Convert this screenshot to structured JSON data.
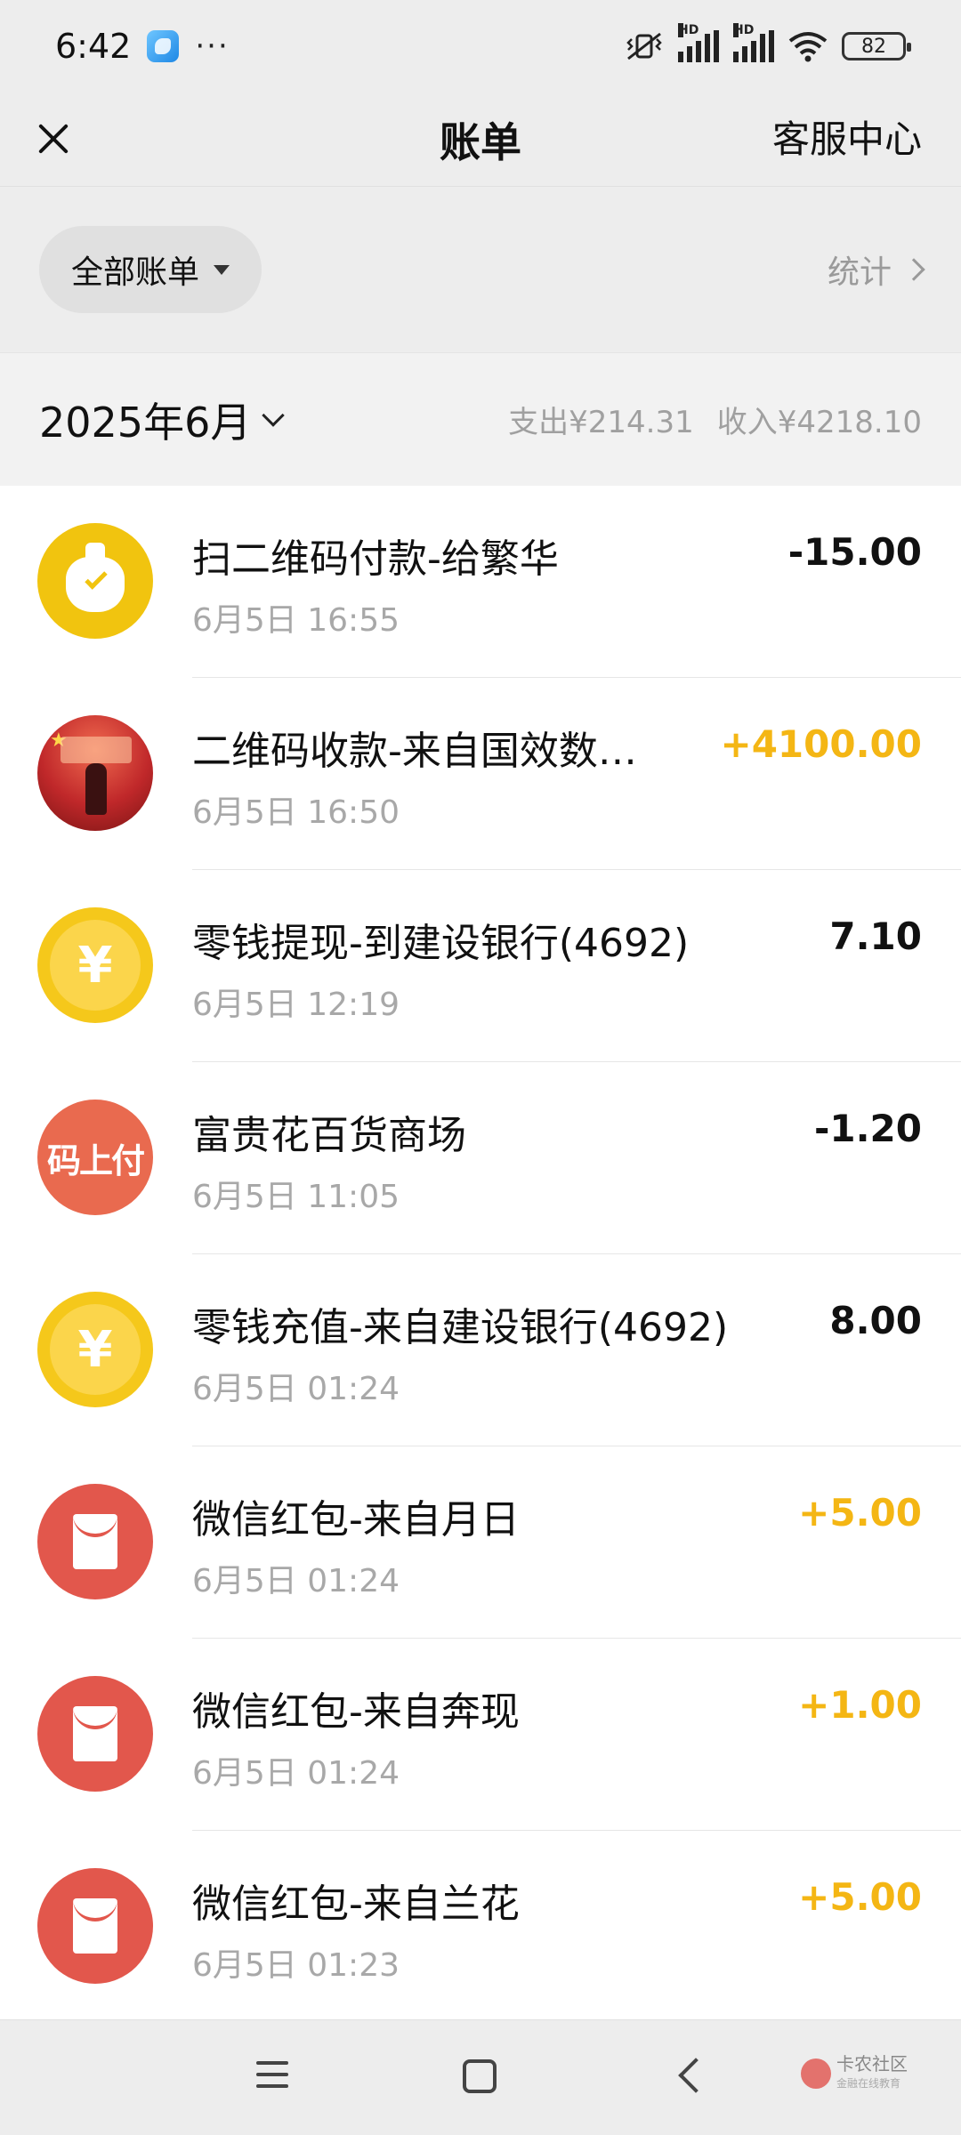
{
  "status_bar": {
    "time": "6:42",
    "more": "···",
    "hd1": "HD",
    "hd2": "HD",
    "battery": "82"
  },
  "header": {
    "title": "账单",
    "service": "客服中心"
  },
  "filter": {
    "label": "全部账单",
    "stats": "统计"
  },
  "month": {
    "label": "2025年6月",
    "expense": "支出¥214.31",
    "income": "收入¥4218.10"
  },
  "transactions": [
    {
      "title": "扫二维码付款-给繁华",
      "time": "6月5日 16:55",
      "amount": "-15.00",
      "type": "expense",
      "icon": "money-bag-icon"
    },
    {
      "title": "二维码收款-来自国效数…",
      "time": "6月5日 16:50",
      "amount": "+4100.00",
      "type": "income",
      "icon": "user-avatar"
    },
    {
      "title": "零钱提现-到建设银行(4692)",
      "time": "6月5日 12:19",
      "amount": "7.10",
      "type": "neutral",
      "icon": "yuan-coin-icon"
    },
    {
      "title": "富贵花百货商场",
      "time": "6月5日 11:05",
      "amount": "-1.20",
      "type": "expense",
      "icon": "code-pay-icon"
    },
    {
      "title": "零钱充值-来自建设银行(4692)",
      "time": "6月5日 01:24",
      "amount": "8.00",
      "type": "neutral",
      "icon": "yuan-coin-icon"
    },
    {
      "title": "微信红包-来自月日",
      "time": "6月5日 01:24",
      "amount": "+5.00",
      "type": "income",
      "icon": "red-packet-icon"
    },
    {
      "title": "微信红包-来自奔现",
      "time": "6月5日 01:24",
      "amount": "+1.00",
      "type": "income",
      "icon": "red-packet-icon"
    },
    {
      "title": "微信红包-来自兰花",
      "time": "6月5日 01:23",
      "amount": "+5.00",
      "type": "income",
      "icon": "red-packet-icon"
    }
  ],
  "avatar_text": {
    "code_pay": "码上付",
    "coin": "¥"
  },
  "watermark": {
    "title": "卡农社区",
    "subtitle": "金融在线教育"
  },
  "colors": {
    "income": "#f4b614",
    "background": "#ededed",
    "red_packet": "#e2574c",
    "coin": "#f5c81b"
  }
}
